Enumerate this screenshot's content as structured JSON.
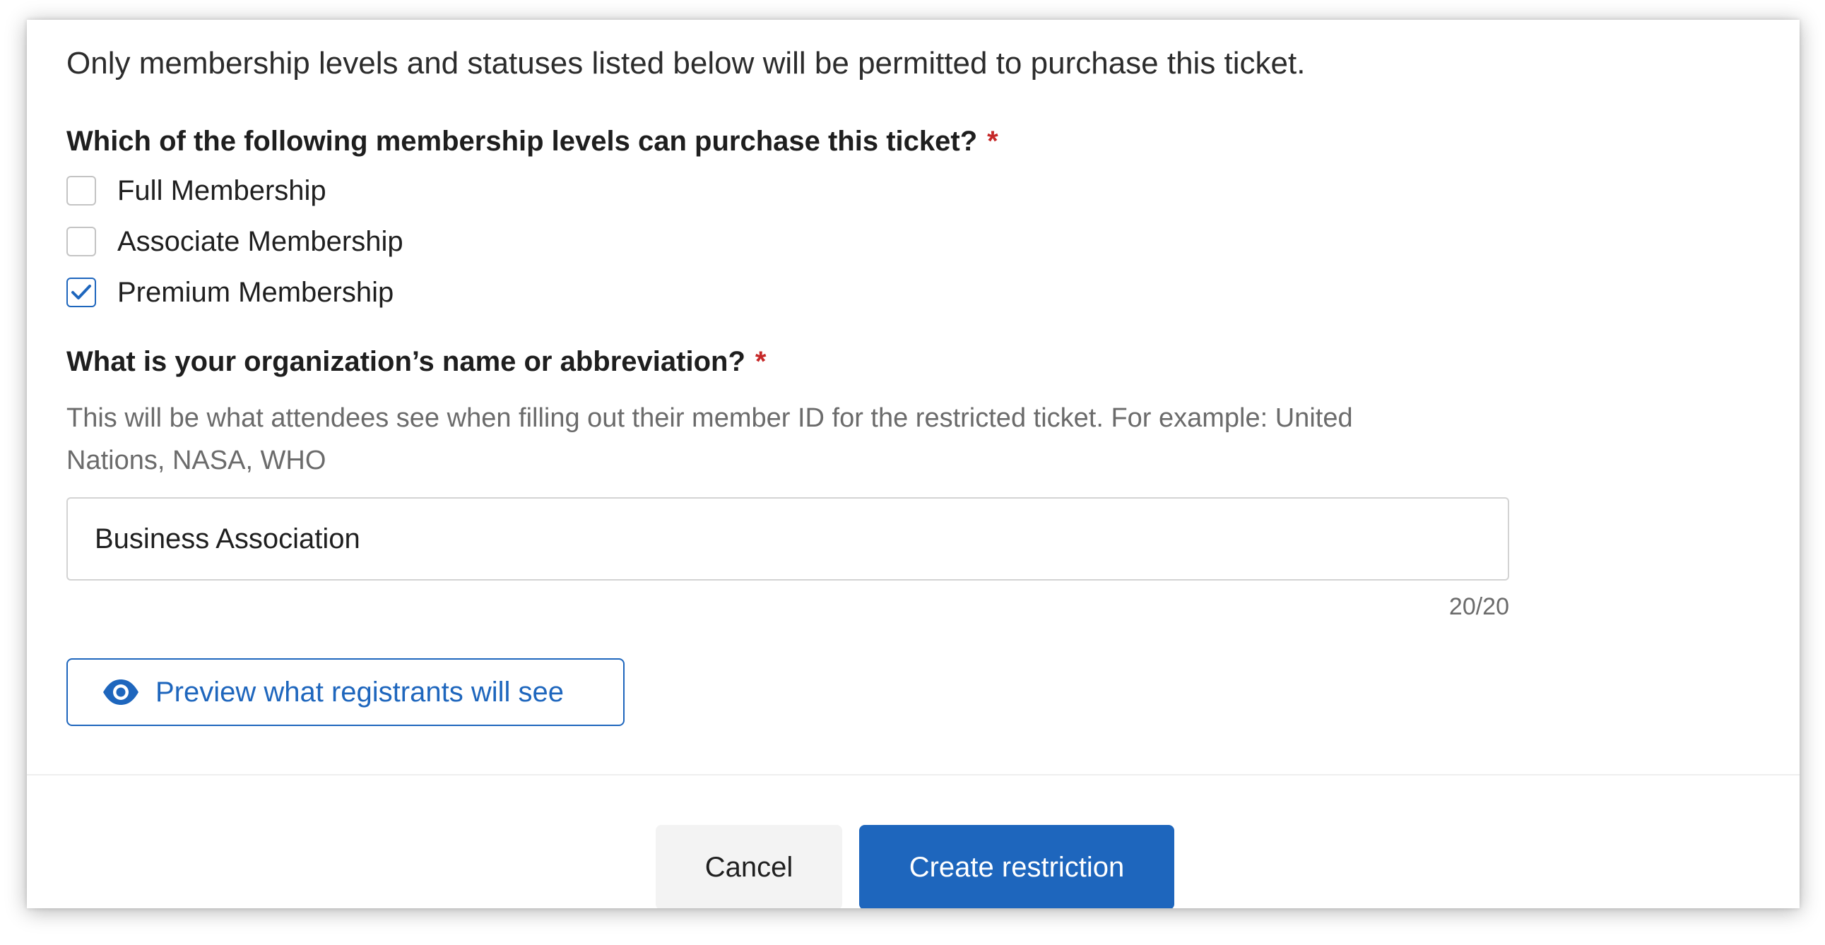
{
  "intro": "Only membership levels and statuses listed below will be permitted to purchase this ticket.",
  "membership_question": {
    "label": "Which of the following membership levels can purchase this ticket?",
    "required_mark": "*"
  },
  "options": [
    {
      "label": "Full Membership",
      "checked": false
    },
    {
      "label": "Associate Membership",
      "checked": false
    },
    {
      "label": "Premium Membership",
      "checked": true
    }
  ],
  "org_question": {
    "label": "What is your organization’s name or abbreviation?",
    "required_mark": "*",
    "help": "This will be what attendees see when filling out their member ID for the restricted ticket. For example: United Nations, NASA, WHO",
    "value": "Business Association",
    "counter": "20/20"
  },
  "preview_button": {
    "label": "Preview what registrants will see",
    "icon": "eye-icon"
  },
  "footer": {
    "cancel_label": "Cancel",
    "create_label": "Create restriction"
  },
  "colors": {
    "accent": "#1e66bd",
    "required": "#c62828",
    "muted_text": "#6b6b6b",
    "cancel_bg": "#f3f3f3"
  }
}
